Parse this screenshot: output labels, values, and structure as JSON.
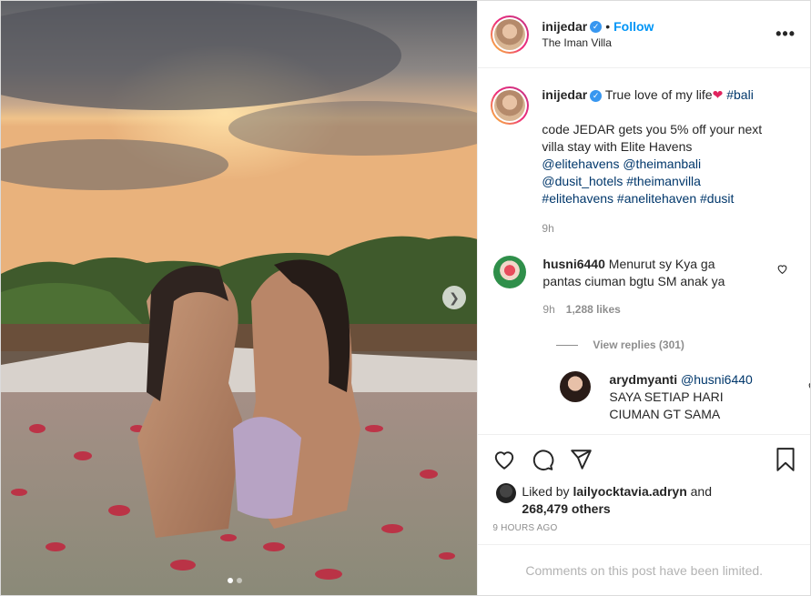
{
  "post": {
    "username": "inijedar",
    "follow_label": "Follow",
    "location": "The Iman Villa",
    "more_label": "•••",
    "caption": {
      "username": "inijedar",
      "text_line1": "True love of my life",
      "hashtag_first": "#bali",
      "text_line2": "code JEDAR gets you 5% off your next villa stay with Elite Havens",
      "mentions": [
        "@elitehavens",
        "@theimanbali",
        "@dusit_hotels",
        "#theimanvilla",
        "#elitehavens",
        "#anelitehaven",
        "#dusit"
      ],
      "time": "9h"
    },
    "comments": [
      {
        "username": "husni6440",
        "text": "Menurut sy Kya ga pantas ciuman bgtu SM anak ya",
        "time": "9h",
        "likes": "1,288 likes"
      }
    ],
    "view_replies": "View replies (301)",
    "reply": {
      "username": "arydmyanti",
      "mention": "@husni6440",
      "text": "SAYA SETIAP HARI CIUMAN GT SAMA"
    },
    "liked_by": {
      "prefix": "Liked by",
      "user": "lailyocktavia.adryn",
      "and": "and",
      "count": "268,479 others"
    },
    "posted_ago": "9 HOURS AGO",
    "comments_limited": "Comments on this post have been limited.",
    "carousel": {
      "current": 1,
      "total": 2
    },
    "icons": [
      "heart-icon",
      "comment-icon",
      "share-icon",
      "bookmark-icon",
      "chevron-right-icon",
      "more-icon",
      "verified-icon"
    ],
    "colors": {
      "accent": "#0095f6",
      "tag": "#00376b",
      "muted": "#8e8e8e",
      "verified": "#3897f0"
    }
  }
}
